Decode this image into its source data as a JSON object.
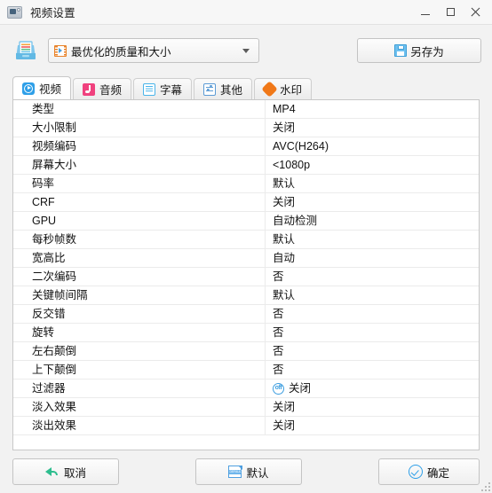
{
  "window": {
    "title": "视频设置",
    "app_icon": "video-settings-icon",
    "controls": {
      "minimize": "minimize-icon",
      "maximize": "maximize-icon",
      "close": "close-icon"
    }
  },
  "toolbar": {
    "tray_icon": "profile-tray-icon",
    "preset": {
      "icon": "film-strip-icon",
      "value": "最优化的质量和大小"
    },
    "save_as": {
      "icon": "floppy-disk-icon",
      "label": "另存为"
    }
  },
  "tabs": [
    {
      "label": "视频",
      "icon": "video-play-icon",
      "active": true
    },
    {
      "label": "音频",
      "icon": "music-note-icon",
      "active": false
    },
    {
      "label": "字幕",
      "icon": "subtitle-lines-icon",
      "active": false
    },
    {
      "label": "其他",
      "icon": "sliders-icon",
      "active": false
    },
    {
      "label": "水印",
      "icon": "watermark-badge-icon",
      "active": false
    }
  ],
  "settings_table": {
    "rows": [
      {
        "label": "类型",
        "value": "MP4"
      },
      {
        "label": "大小限制",
        "value": "关闭"
      },
      {
        "label": "视频编码",
        "value": "AVC(H264)"
      },
      {
        "label": "屏幕大小",
        "value": "<1080p"
      },
      {
        "label": "码率",
        "value": "默认"
      },
      {
        "label": "CRF",
        "value": "关闭"
      },
      {
        "label": "GPU",
        "value": "自动检测"
      },
      {
        "label": "每秒帧数",
        "value": "默认"
      },
      {
        "label": "宽高比",
        "value": "自动"
      },
      {
        "label": "二次编码",
        "value": "否"
      },
      {
        "label": "关键帧间隔",
        "value": "默认"
      },
      {
        "label": "反交错",
        "value": "否"
      },
      {
        "label": "旋转",
        "value": "否"
      },
      {
        "label": "左右颠倒",
        "value": "否"
      },
      {
        "label": "上下颠倒",
        "value": "否"
      },
      {
        "label": "过滤器",
        "value": "关闭",
        "icon": "off-badge-icon",
        "icon_text": "off"
      },
      {
        "label": "淡入效果",
        "value": "关闭"
      },
      {
        "label": "淡出效果",
        "value": "关闭"
      }
    ]
  },
  "footer": {
    "cancel": {
      "label": "取消",
      "icon": "back-arrow-icon"
    },
    "default": {
      "label": "默认",
      "icon": "default-document-icon",
      "icon_text": "DEFAULT"
    },
    "ok": {
      "label": "确定",
      "icon": "check-circle-icon"
    }
  },
  "colors": {
    "accent_blue": "#2e9fe8",
    "audio_pink": "#f0417e",
    "watermark_orange": "#f07818",
    "cancel_green": "#2ebd8e",
    "preset_orange": "#e8822a",
    "window_bg": "#f2f2f2",
    "panel_bg": "#ffffff"
  }
}
